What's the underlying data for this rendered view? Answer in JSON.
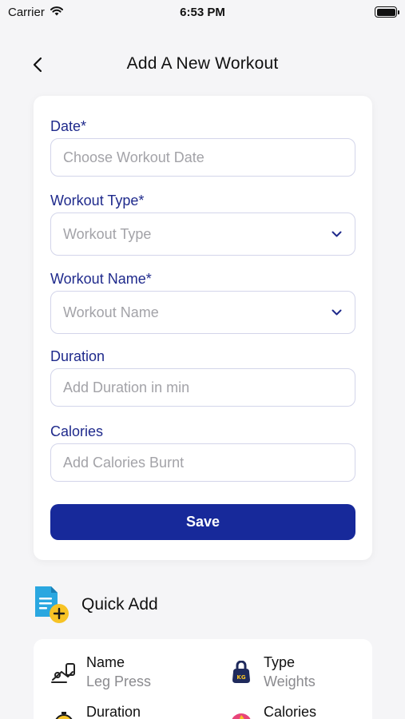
{
  "status": {
    "carrier": "Carrier",
    "time": "6:53 PM"
  },
  "header": {
    "title": "Add A New Workout"
  },
  "form": {
    "date": {
      "label": "Date*",
      "placeholder": "Choose Workout Date"
    },
    "workout_type": {
      "label": "Workout Type*",
      "placeholder": "Workout Type"
    },
    "workout_name": {
      "label": "Workout Name*",
      "placeholder": "Workout Name"
    },
    "duration": {
      "label": "Duration",
      "placeholder": "Add Duration in min"
    },
    "calories": {
      "label": "Calories",
      "placeholder": "Add Calories Burnt"
    },
    "save_label": "Save"
  },
  "quick_add": {
    "title": "Quick Add",
    "items": [
      {
        "label": "Name",
        "value": "Leg Press",
        "icon": "leg-press-icon"
      },
      {
        "label": "Type",
        "value": "Weights",
        "icon": "kettlebell-icon"
      },
      {
        "label": "Duration",
        "value": "",
        "icon": "stopwatch-icon"
      },
      {
        "label": "Calories",
        "value": "",
        "icon": "flame-icon"
      }
    ]
  },
  "colors": {
    "accent": "#17299a",
    "label": "#1f2a8c",
    "background": "#f5f5f7",
    "placeholder": "#a3a3a8"
  }
}
